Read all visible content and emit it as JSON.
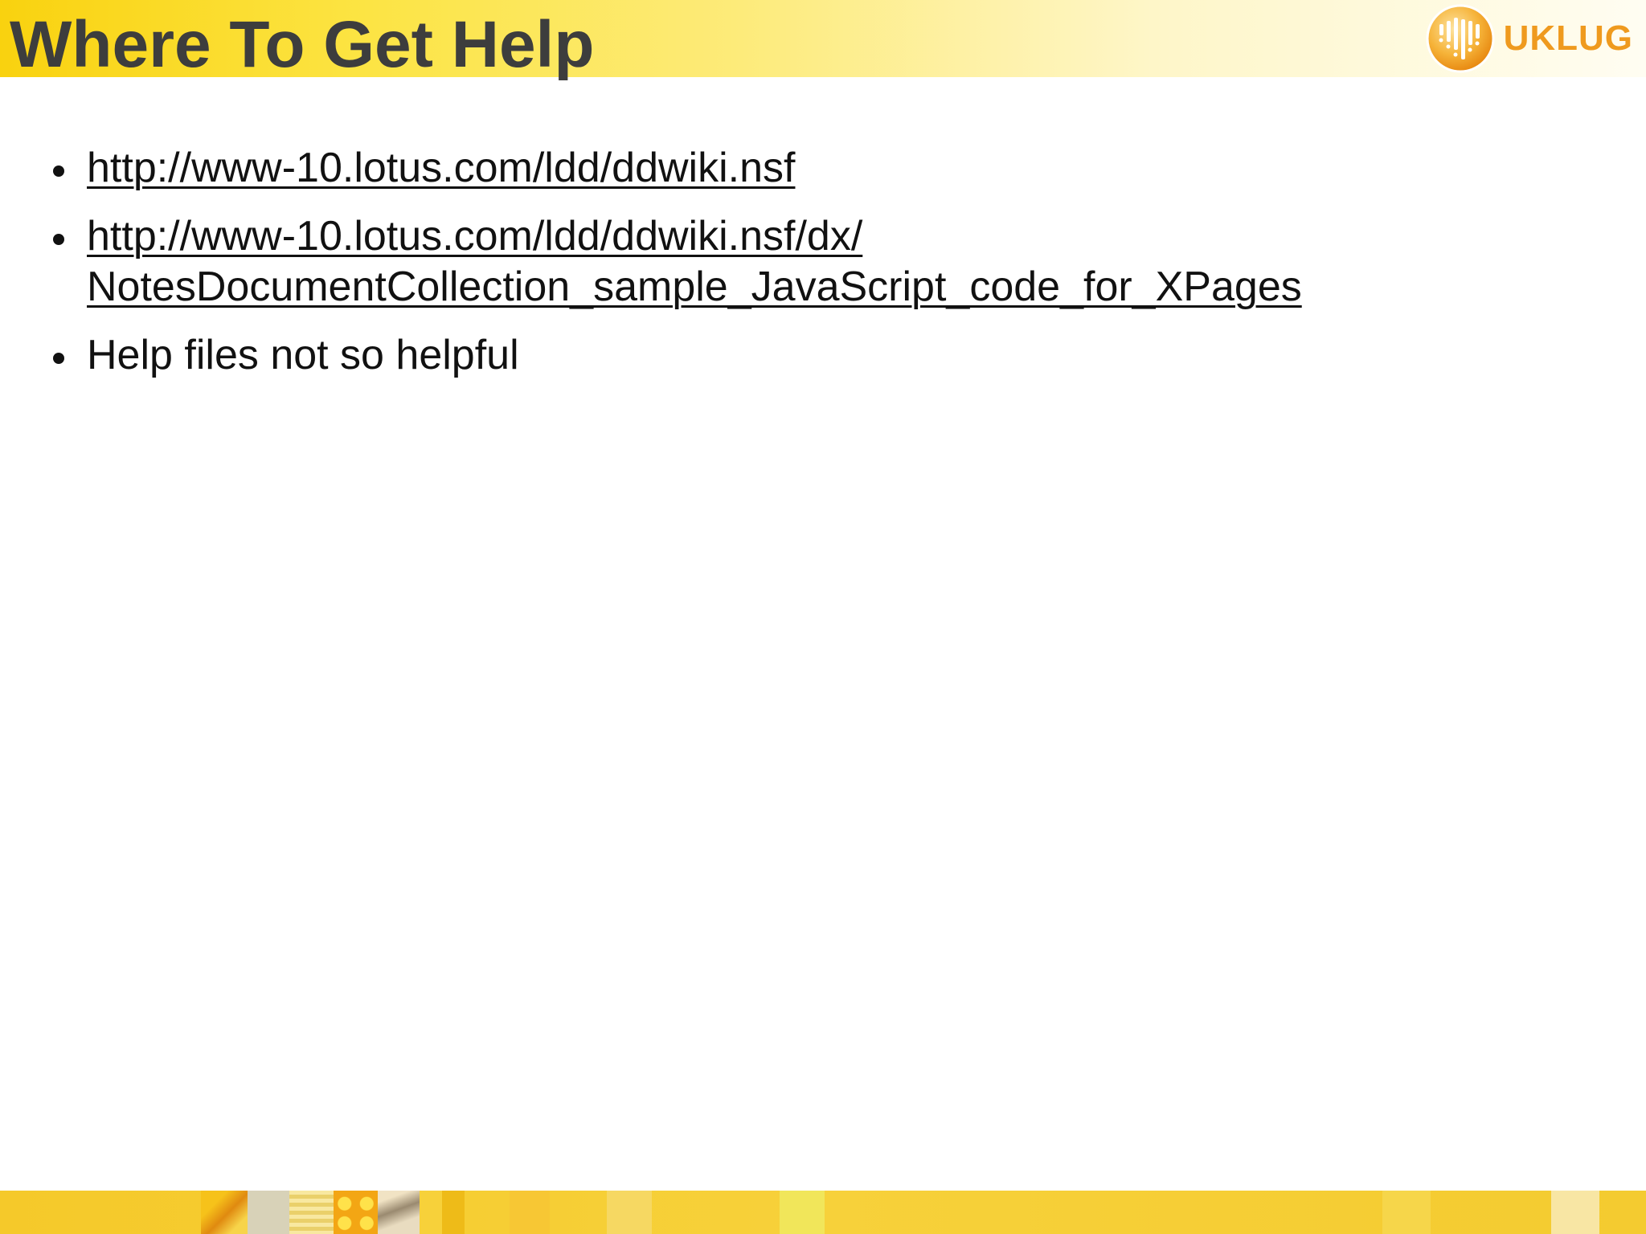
{
  "slide": {
    "title": "Where To Get Help",
    "logo_text": "UKLUG",
    "colors": {
      "title_band": "#f9d20f",
      "title_text": "#3d3d3d",
      "logo": "#ef9a1e",
      "footer_band": "#f5c92a"
    }
  },
  "bullets": [
    {
      "type": "link",
      "lines": [
        "http://www-10.lotus.com/ldd/ddwiki.nsf"
      ]
    },
    {
      "type": "link",
      "lines": [
        "http://www-10.lotus.com/ldd/ddwiki.nsf/dx/",
        "NotesDocumentCollection_sample_JavaScript_code_for_XPages"
      ]
    },
    {
      "type": "text",
      "text": "Help files not so helpful"
    }
  ]
}
